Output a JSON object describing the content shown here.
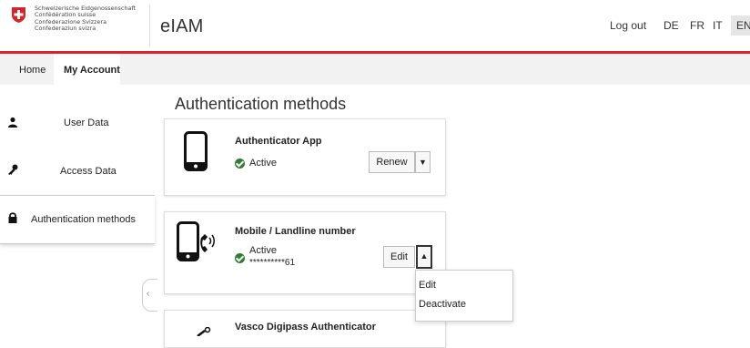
{
  "header": {
    "confederation_lines": [
      "Schweizerische Eidgenossenschaft",
      "Confédération suisse",
      "Confederazione Svizzera",
      "Confederaziun svizra"
    ],
    "app_title": "eIAM",
    "logout_label": "Log out",
    "languages": [
      "DE",
      "FR",
      "IT",
      "EN"
    ],
    "active_language": "EN",
    "accent_color": "#d8232a"
  },
  "nav": {
    "items": [
      "Home",
      "My Account"
    ],
    "active": "My Account"
  },
  "sidebar": {
    "items": [
      {
        "label": "User Data",
        "icon": "user-icon"
      },
      {
        "label": "Access Data",
        "icon": "key-icon"
      },
      {
        "label": "Authentication methods",
        "icon": "lock-icon"
      }
    ],
    "active": "Authentication methods"
  },
  "main": {
    "title": "Authentication methods",
    "cards": [
      {
        "title": "Authenticator App",
        "status": "Active",
        "action": "Renew",
        "icon": "smartphone-icon"
      },
      {
        "title": "Mobile / Landline number",
        "status": "Active",
        "detail": "**********61",
        "action": "Edit",
        "icon": "phone-call-icon"
      },
      {
        "title": "Vasco Digipass Authenticator",
        "icon": "token-icon"
      }
    ],
    "status_color": "#2e7d32",
    "dropdown_items": [
      "Edit",
      "Deactivate"
    ]
  }
}
